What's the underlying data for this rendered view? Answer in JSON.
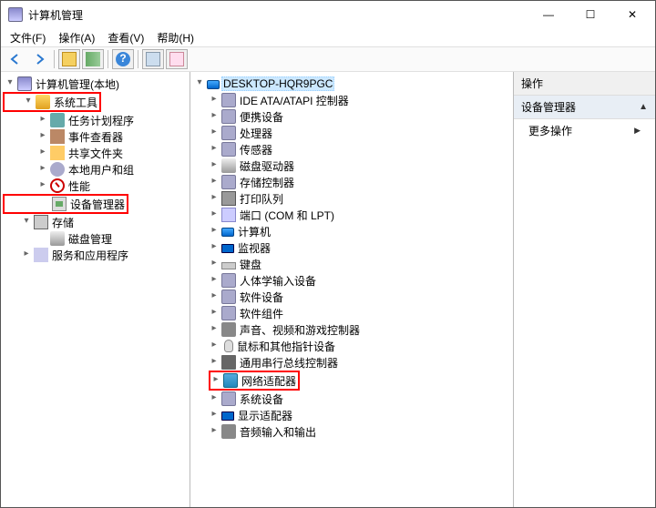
{
  "window": {
    "title": "计算机管理",
    "min": "—",
    "max": "☐",
    "close": "✕"
  },
  "menu": {
    "file": "文件(F)",
    "action": "操作(A)",
    "view": "查看(V)",
    "help": "帮助(H)"
  },
  "left_tree": {
    "root": "计算机管理(本地)",
    "system_tools": "系统工具",
    "task_scheduler": "任务计划程序",
    "event_viewer": "事件查看器",
    "shared_folders": "共享文件夹",
    "local_users": "本地用户和组",
    "performance": "性能",
    "device_manager": "设备管理器",
    "storage": "存储",
    "disk_mgmt": "磁盘管理",
    "services_apps": "服务和应用程序"
  },
  "center_tree": {
    "root": "DESKTOP-HQR9PGC",
    "items": [
      "IDE ATA/ATAPI 控制器",
      "便携设备",
      "处理器",
      "传感器",
      "磁盘驱动器",
      "存储控制器",
      "打印队列",
      "端口 (COM 和 LPT)",
      "计算机",
      "监视器",
      "键盘",
      "人体学输入设备",
      "软件设备",
      "软件组件",
      "声音、视频和游戏控制器",
      "鼠标和其他指针设备",
      "通用串行总线控制器",
      "网络适配器",
      "系统设备",
      "显示适配器",
      "音频输入和输出"
    ]
  },
  "right": {
    "header": "操作",
    "section": "设备管理器",
    "more": "更多操作"
  }
}
